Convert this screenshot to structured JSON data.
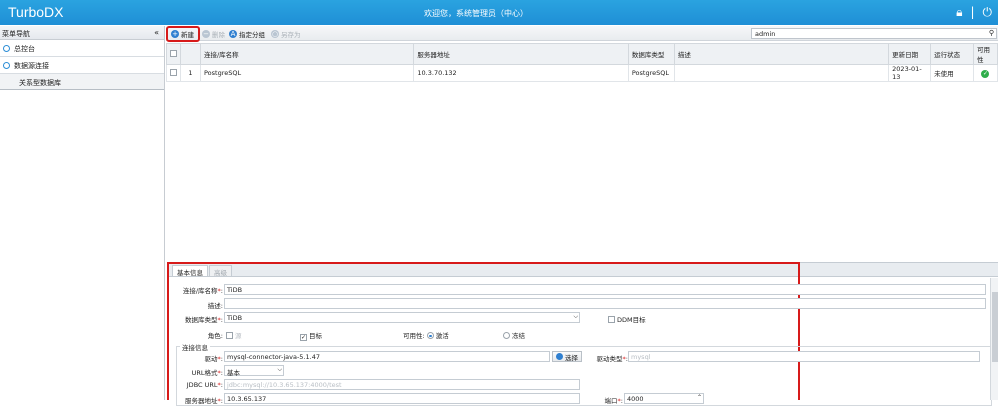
{
  "header": {
    "app_title": "TurboDX",
    "welcome": "欢迎您，系统管理员（中心）"
  },
  "sidebar": {
    "title": "菜单导航",
    "collapse": "«",
    "items": [
      {
        "label": "总控台"
      },
      {
        "label": "数据源连接"
      }
    ],
    "child": "关系型数据库"
  },
  "toolbar": {
    "new_label": "新建",
    "delete_label": "删除",
    "assign_label": "指定分组",
    "saveas_label": "另存为",
    "search_value": "admin"
  },
  "grid": {
    "headers": [
      "",
      "",
      "连接/库名称",
      "服务器地址",
      "数据库类型",
      "描述",
      "更新日期",
      "运行状态",
      "可用性"
    ],
    "rows": [
      {
        "num": "1",
        "name": "PostgreSQL",
        "server": "10.3.70.132",
        "type": "PostgreSQL",
        "desc": "",
        "date": "2023-01-13",
        "status": "未使用",
        "availability": "✓"
      }
    ]
  },
  "detail": {
    "tabs": [
      "基本信息",
      "高级"
    ],
    "name_label": "连接/库名称",
    "name_value": "TiDB",
    "desc_label": "描述",
    "desc_value": "",
    "dbtype_label": "数据库类型",
    "dbtype_value": "TiDB",
    "ddm_label": "DDM目标",
    "role_label": "角色",
    "role_source": "源",
    "role_target": "目标",
    "avail_label": "可用性",
    "avail_active": "激活",
    "avail_frozen": "冻结",
    "conn_legend": "连接信息",
    "driver_label": "驱动",
    "driver_value": "mysql-connector-java-5.1.47",
    "choose_label": "选择",
    "driver_type_label": "驱动类型",
    "driver_type_value": "mysql",
    "url_format_label": "URL格式",
    "url_format_value": "基本",
    "jdbc_label": "JDBC URL",
    "jdbc_value": "jdbc:mysql://10.3.65.137:4000/test",
    "server_label": "服务器地址",
    "server_value": "10.3.65.137",
    "port_label": "端口",
    "port_value": "4000",
    "required_mark": "*",
    "colon": ":"
  }
}
